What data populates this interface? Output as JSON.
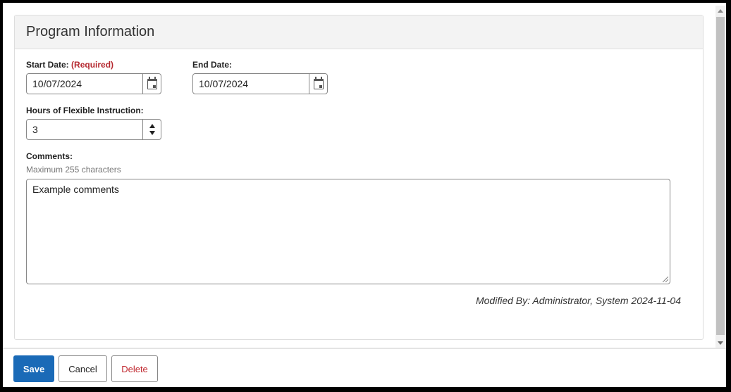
{
  "panel": {
    "title": "Program Information"
  },
  "form": {
    "start_date": {
      "label": "Start Date:",
      "required_label": "(Required)",
      "value": "10/07/2024",
      "icon": "calendar-icon"
    },
    "end_date": {
      "label": "End Date:",
      "value": "10/07/2024",
      "icon": "calendar-icon"
    },
    "hours": {
      "label": "Hours of Flexible Instruction:",
      "value": "3"
    },
    "comments": {
      "label": "Comments:",
      "hint": "Maximum 255 characters",
      "value": "Example comments"
    }
  },
  "modified": "Modified By: Administrator, System 2024-11-04",
  "footer": {
    "save_label": "Save",
    "cancel_label": "Cancel",
    "delete_label": "Delete"
  },
  "colors": {
    "primary": "#1a6ab7",
    "danger": "#c0282f",
    "required": "#b5282f"
  }
}
